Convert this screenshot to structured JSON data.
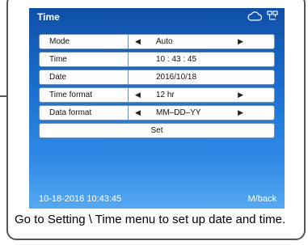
{
  "screen": {
    "title": "Time",
    "icons": [
      "cloud-icon",
      "network-icon"
    ],
    "rows": [
      {
        "label": "Mode",
        "value": "Auto",
        "arrows": true
      },
      {
        "label": "Time",
        "value": "10 : 43 : 45",
        "arrows": false
      },
      {
        "label": "Date",
        "value": "2016/10/18",
        "arrows": false
      },
      {
        "label": "Time format",
        "value": "12 hr",
        "arrows": true
      },
      {
        "label": "Data format",
        "value": "MM–DD–YY",
        "arrows": true
      }
    ],
    "set_label": "Set",
    "footer_datetime": "10-18-2016 10:43:45",
    "footer_back": "M/back"
  },
  "caption": "Go to Setting \\ Time menu to set up date and time.",
  "colors": {
    "screen_top": "#0f4fa6",
    "screen_bottom": "#56a8f0",
    "row_border": "#6d8fb8"
  }
}
